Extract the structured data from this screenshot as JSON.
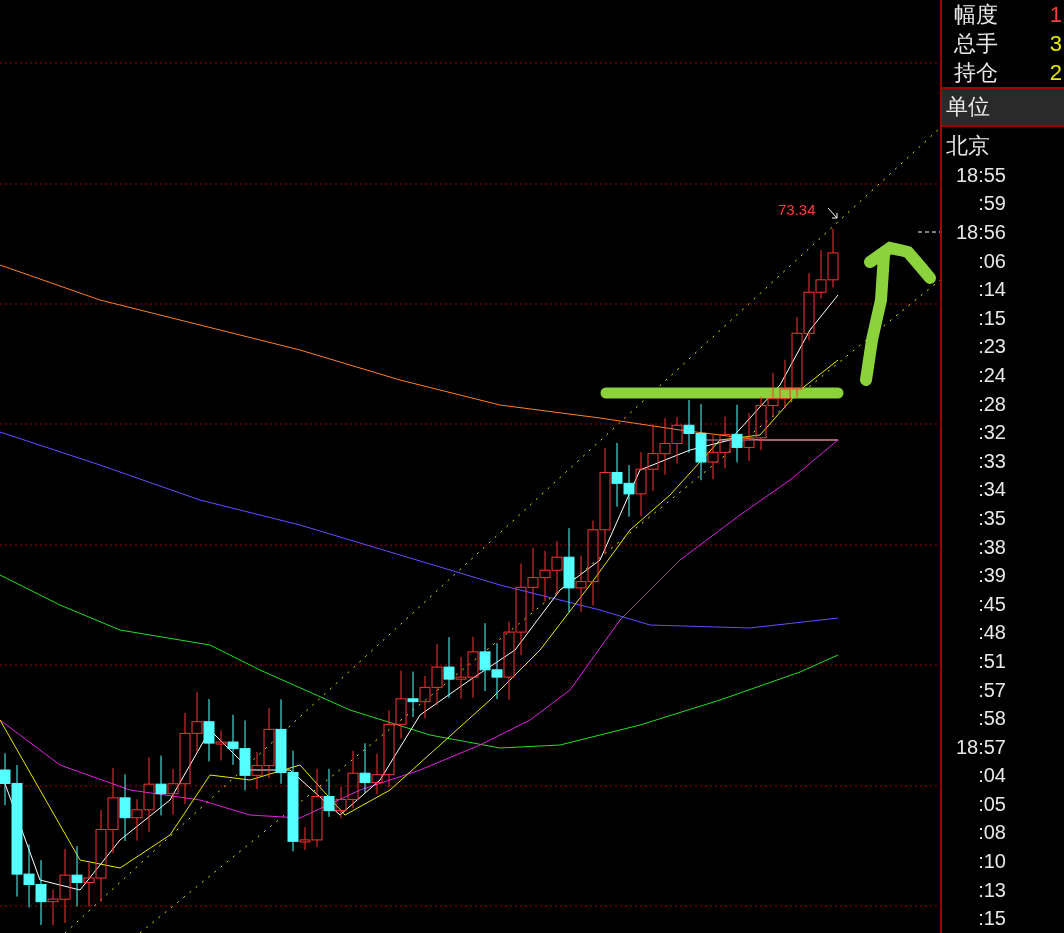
{
  "chart": {
    "price_label": "73.34"
  },
  "quote_panel": {
    "rows": [
      {
        "label": "幅度",
        "value": "1",
        "color": "#ff3b3b"
      },
      {
        "label": "总手",
        "value": "3",
        "color": "#e8e800"
      },
      {
        "label": "持仓",
        "value": "2",
        "color": "#e8e800"
      }
    ],
    "unit_header": "单位",
    "location": "北京",
    "times": [
      "18:55",
      ":59",
      "18:56",
      ":06",
      ":14",
      ":15",
      ":23",
      ":24",
      ":28",
      ":32",
      ":33",
      ":34",
      ":35",
      ":38",
      ":39",
      ":45",
      ":48",
      ":51",
      ":57",
      ":58",
      "18:57",
      ":04",
      ":05",
      ":08",
      ":10",
      ":13",
      ":15"
    ]
  }
}
